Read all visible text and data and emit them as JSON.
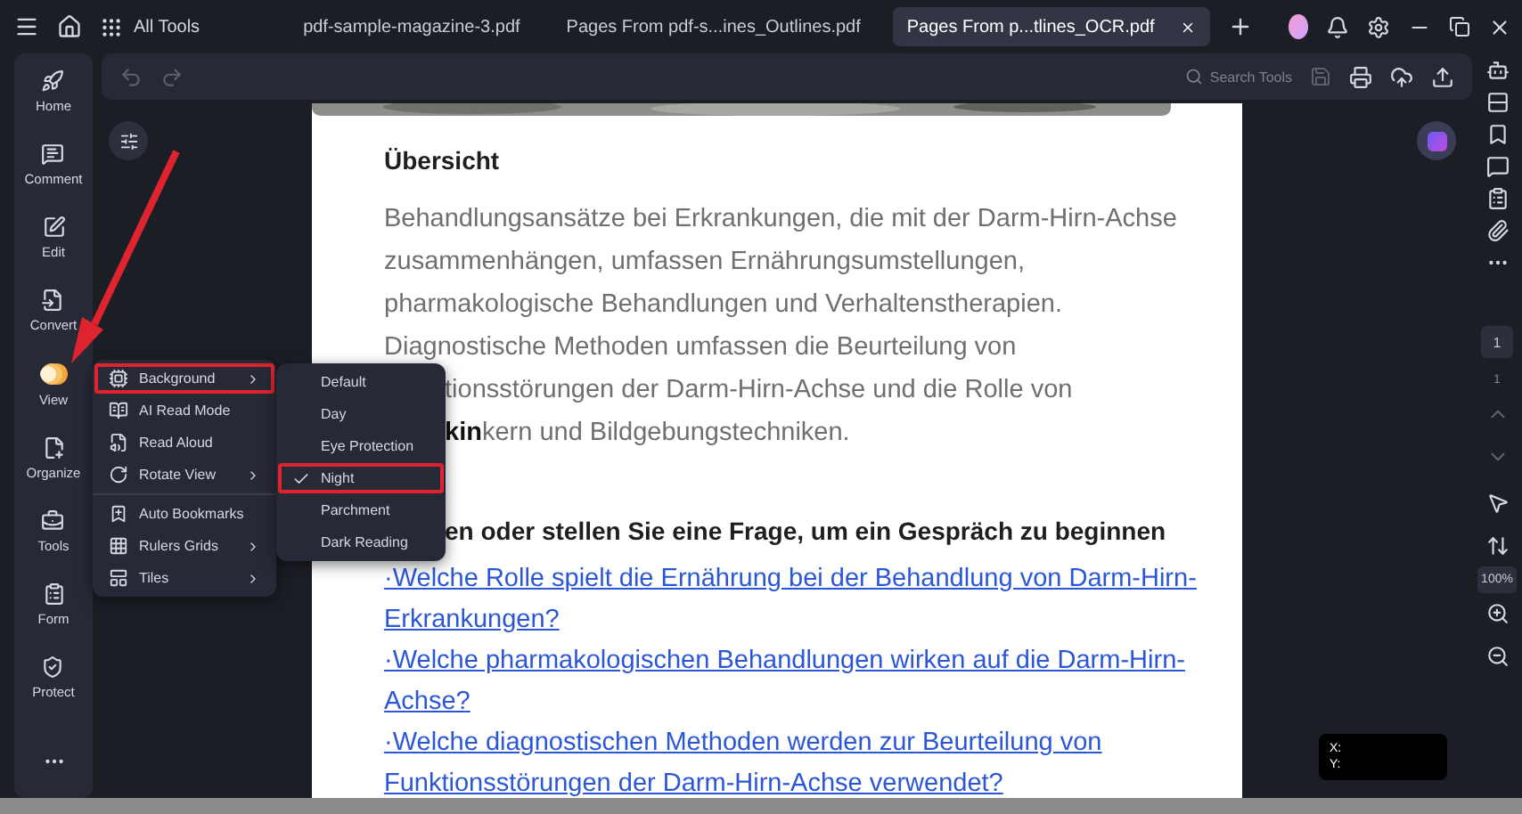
{
  "top_bar": {
    "all_tools": "All Tools",
    "tabs": [
      {
        "label": "pdf-sample-magazine-3.pdf",
        "selected": false
      },
      {
        "label": "Pages From pdf-s...ines_Outlines.pdf",
        "selected": false
      },
      {
        "label": "Pages From p...tlines_OCR.pdf",
        "selected": true
      }
    ]
  },
  "toolbar": {
    "search": {
      "placeholder": "Search Tools"
    }
  },
  "sidebar": {
    "items": [
      {
        "label": "Home"
      },
      {
        "label": "Comment"
      },
      {
        "label": "Edit"
      },
      {
        "label": "Convert"
      },
      {
        "label": "View"
      },
      {
        "label": "Organize"
      },
      {
        "label": "Tools"
      },
      {
        "label": "Form"
      },
      {
        "label": "Protect"
      }
    ]
  },
  "view_menu": {
    "items": [
      {
        "label": "Background",
        "submenu": true,
        "highlighted": true
      },
      {
        "label": "AI Read Mode",
        "submenu": false,
        "highlighted": false
      },
      {
        "label": "Read Aloud",
        "submenu": false,
        "highlighted": false
      },
      {
        "label": "Rotate View",
        "submenu": true,
        "highlighted": false
      },
      {
        "label": "Auto Bookmarks",
        "submenu": false,
        "highlighted": false
      },
      {
        "label": "Rulers  Grids",
        "submenu": true,
        "highlighted": false
      },
      {
        "label": "Tiles",
        "submenu": true,
        "highlighted": false
      }
    ]
  },
  "background_menu": {
    "items": [
      {
        "label": "Default",
        "selected": false,
        "highlighted": false
      },
      {
        "label": "Day",
        "selected": false,
        "highlighted": false
      },
      {
        "label": "Eye Protection",
        "selected": false,
        "highlighted": false
      },
      {
        "label": "Night",
        "selected": true,
        "highlighted": true
      },
      {
        "label": "Parchment",
        "selected": false,
        "highlighted": false
      },
      {
        "label": "Dark Reading",
        "selected": false,
        "highlighted": false
      }
    ]
  },
  "document": {
    "heading": "Übersicht",
    "lines": [
      {
        "text": "Behandlungsansätze bei Erkrankungen, die mit der Darm-Hirn-Achse",
        "kind": "full"
      },
      {
        "text": "zusammenhängen, umfassen Ernährungsumstellungen,",
        "kind": "full"
      },
      {
        "text": "pharmakologische Behandlungen und Verhaltenstherapien.",
        "kind": "full"
      },
      {
        "text": "Diagnostische Methoden umfassen die Beurteilung von",
        "kind": "full"
      },
      {
        "text": "tionsstörungen der Darm-Hirn-Achse und die Rolle von",
        "kind": "partial"
      },
      {
        "text": "kern und Bildgebungstechniken.",
        "kind": "partial",
        "prefix": "kin"
      }
    ],
    "question_heading": "en oder stellen Sie eine Frage, um ein Gespräch zu beginnen",
    "links": [
      "·Welche Rolle spielt die Ernährung bei der Behandlung von Darm-Hirn-",
      "Erkrankungen?",
      "·Welche pharmakologischen Behandlungen wirken auf die Darm-Hirn-",
      "Achse?",
      "·Welche diagnostischen Methoden werden zur Beurteilung von",
      "Funktionsstörungen der Darm-Hirn-Achse verwendet?"
    ]
  },
  "coordinates": {
    "x_label": "X:",
    "y_label": "Y:"
  },
  "right_rail": {
    "page_input": "1",
    "page_total": "1",
    "zoom": "100%"
  }
}
